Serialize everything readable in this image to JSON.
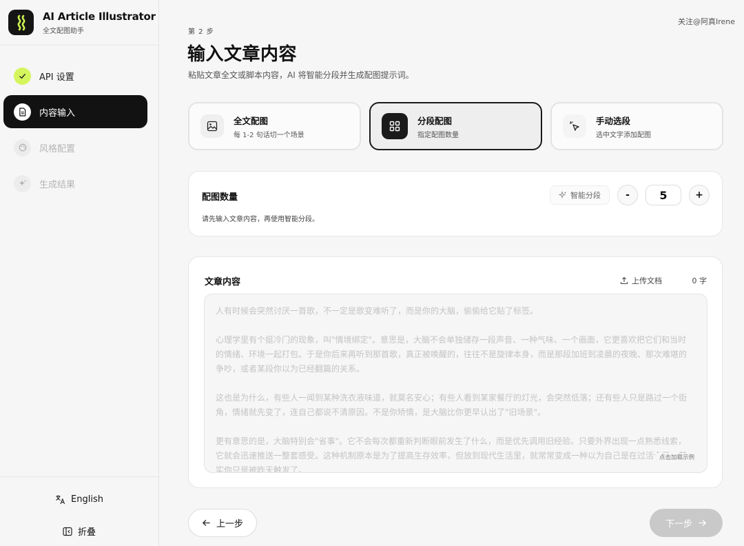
{
  "app": {
    "title": "AI Article Illustrator",
    "subtitle": "全文配图助手",
    "follow": "关注@阿真Irene"
  },
  "sidebar": {
    "items": [
      {
        "label": "API 设置",
        "state": "done",
        "icon": "check-icon"
      },
      {
        "label": "内容输入",
        "state": "active",
        "icon": "document-icon"
      },
      {
        "label": "风格配置",
        "state": "disabled",
        "icon": "palette-icon"
      },
      {
        "label": "生成结果",
        "state": "disabled",
        "icon": "sparkle-icon"
      }
    ],
    "language": "English",
    "collapse": "折叠"
  },
  "header": {
    "step": "第 2 步",
    "title": "输入文章内容",
    "subtitle": "粘贴文章全文或脚本内容，AI 将智能分段并生成配图提示词。"
  },
  "modes": [
    {
      "title": "全文配图",
      "desc": "每 1-2 句话切一个场景",
      "icon": "image-icon",
      "selected": false
    },
    {
      "title": "分段配图",
      "desc": "指定配图数量",
      "icon": "grid-icon",
      "selected": true
    },
    {
      "title": "手动选段",
      "desc": "选中文字添加配图",
      "icon": "pointer-click-icon",
      "selected": false
    }
  ],
  "count": {
    "title": "配图数量",
    "hint": "请先输入文章内容，再使用智能分段。",
    "smart_label": "智能分段",
    "minus": "-",
    "plus": "+",
    "value": "5"
  },
  "article": {
    "title": "文章内容",
    "upload_label": "上传文档",
    "char_count": "0 字",
    "placeholder": [
      "人有时候会突然讨厌一首歌，不一定是歌变难听了，而是你的大脑，偷偷给它贴了标签。",
      "心理学里有个挺冷门的现象，叫\"情境绑定\"。意思是，大脑不会单独储存一段声音、一种气味、一个画面，它更喜欢把它们和当时的情绪、环境一起打包。于是你后来再听到那首歌，真正被唤醒的，往往不是旋律本身，而是那段加班到凌晨的夜晚、那次难堪的争吵，或者某段你以为已经翻篇的关系。",
      "这也是为什么，有些人一闻到某种洗衣液味道，就莫名安心；有些人看到某家餐厅的灯光，会突然低落；还有些人只是路过一个街角，情绪就先变了，连自己都说不清原因。不是你矫情，是大脑比你更早认出了\"旧场景\"。",
      "更有意思的是，大脑特别会\"省事\"。它不会每次都重新判断眼前发生了什么，而是优先调用旧经验。只要外界出现一点熟悉线索，它就会迅速推送一整套感受。这种机制原本是为了提高生存效率，但放到现代生活里，就常常变成一种以为自己是在过活今天，其实你只是被昨天触发了。"
    ],
    "load_sample": "点击加载示例"
  },
  "footer": {
    "prev_label": "上一步",
    "next_label": "下一步"
  }
}
